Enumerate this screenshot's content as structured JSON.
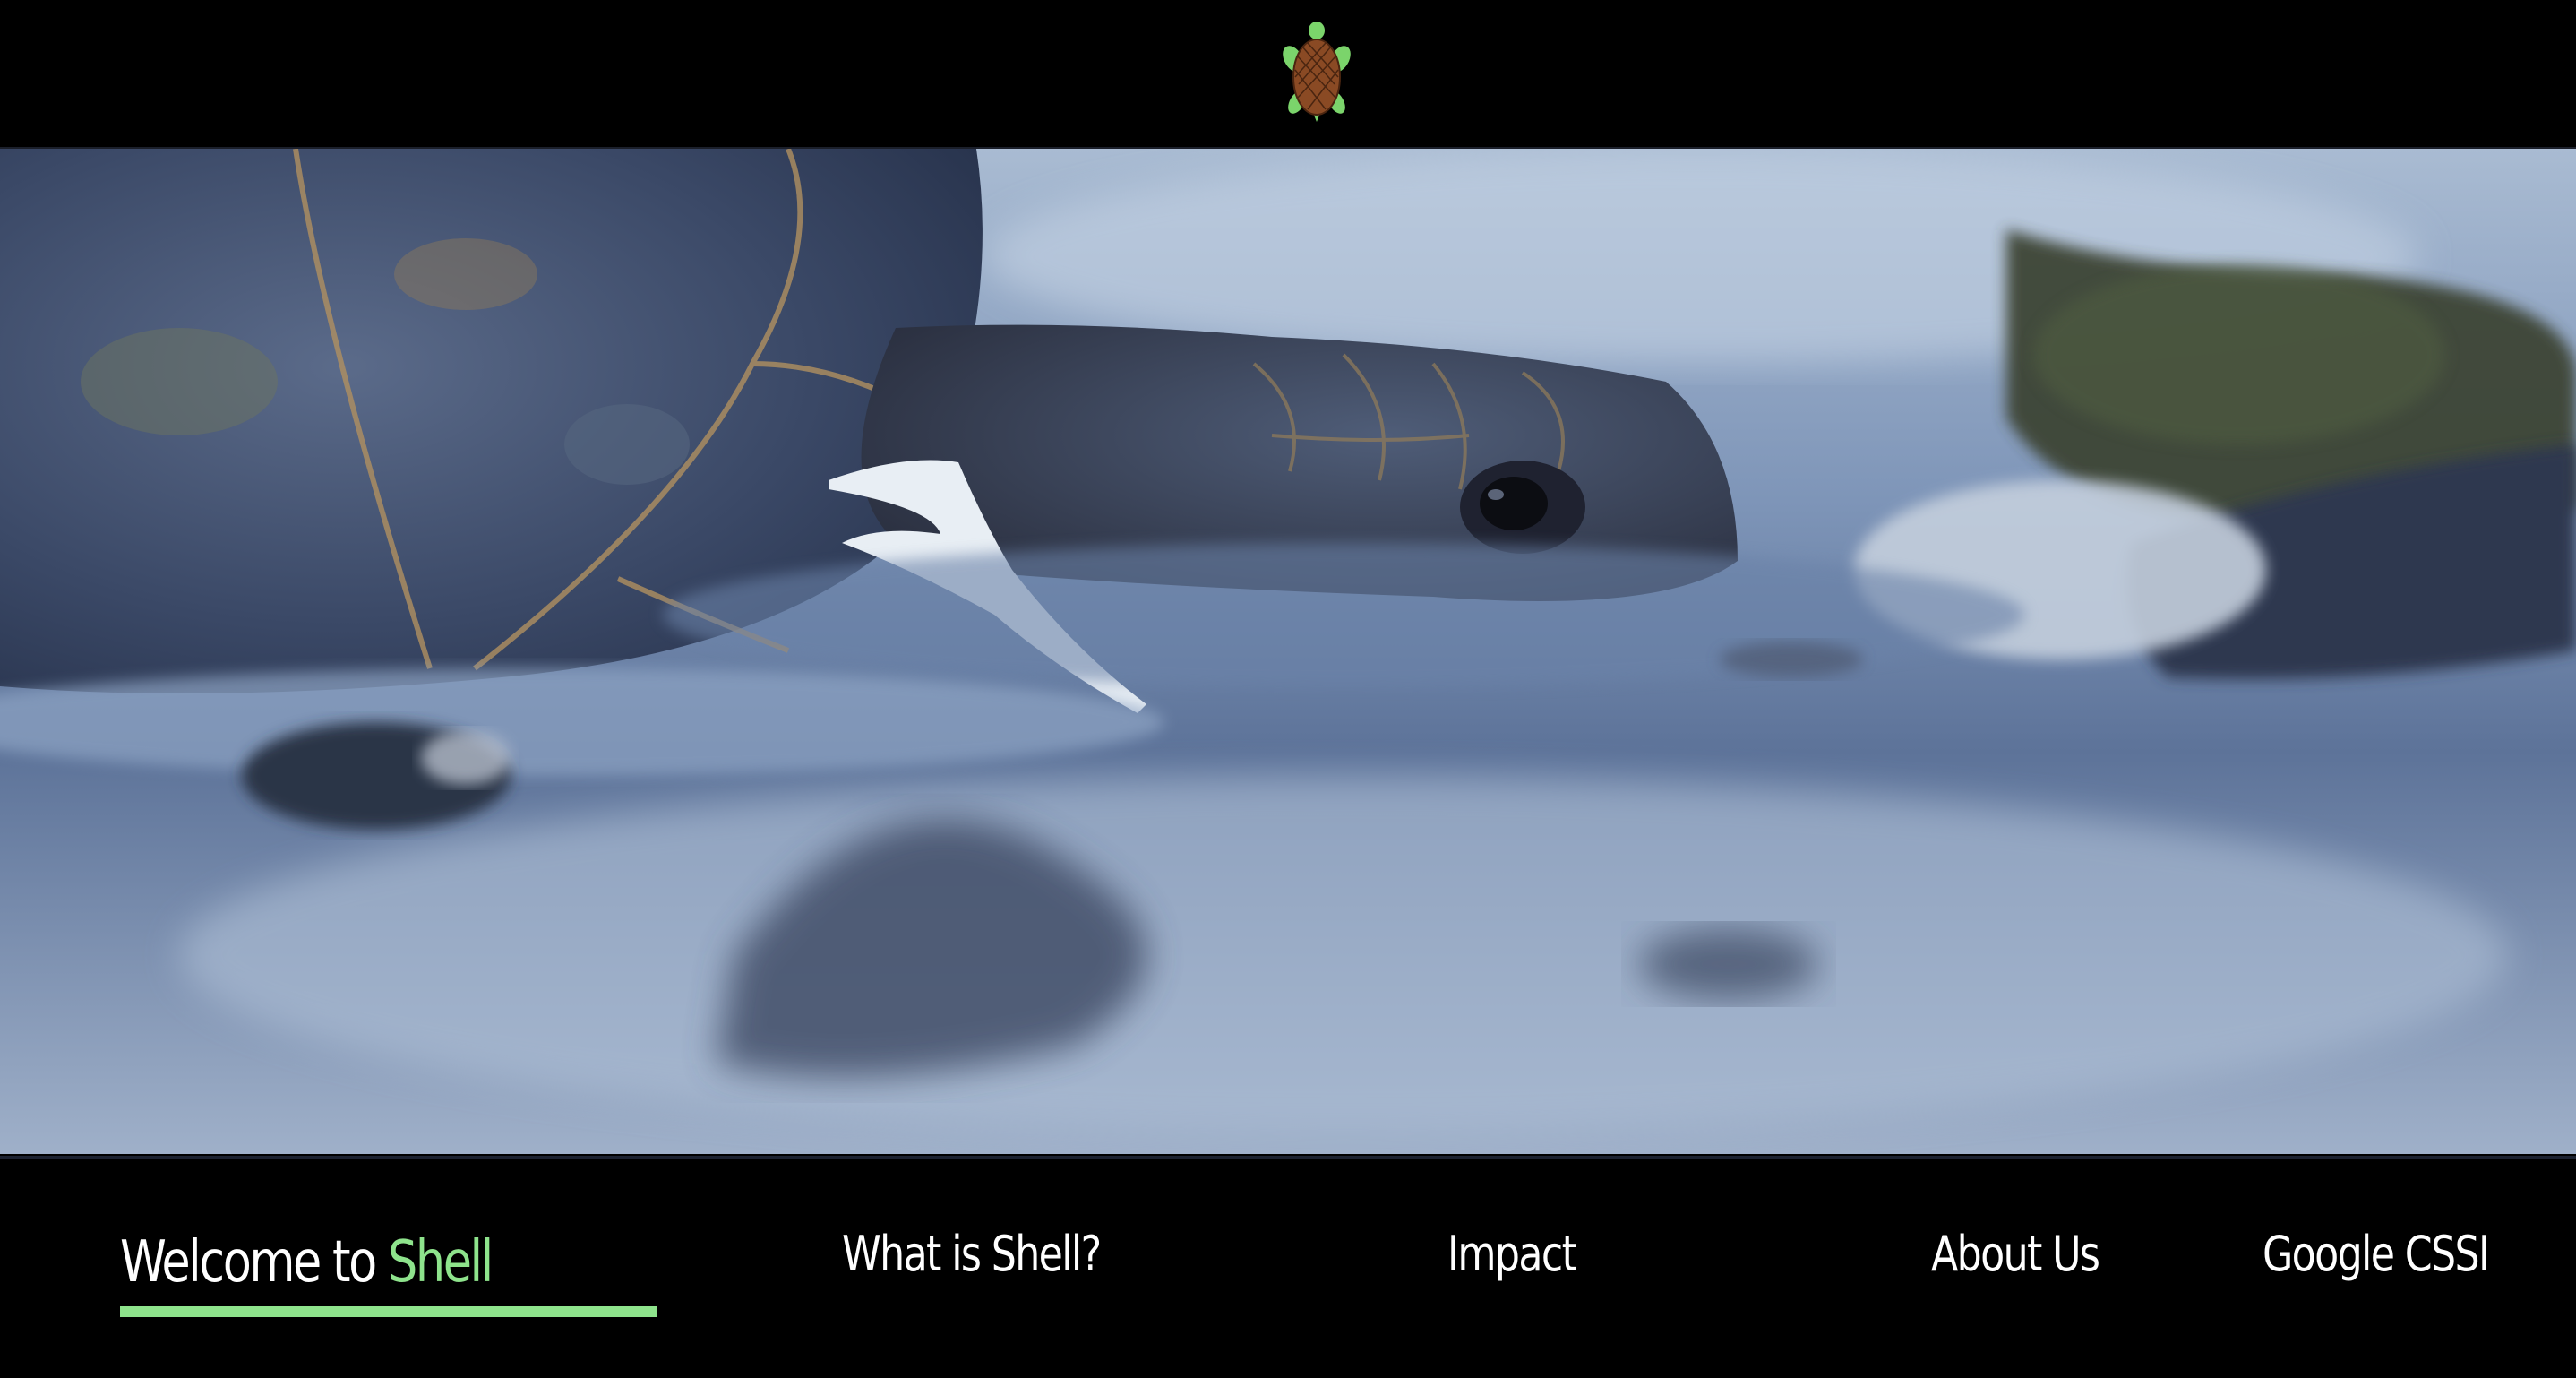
{
  "header": {
    "logo_icon": "turtle-icon"
  },
  "hero": {
    "image": "sea-turtle-with-plastic-photo"
  },
  "footer_nav": {
    "welcome_prefix": "Welcome to ",
    "brand": "Shell",
    "items": [
      {
        "label": "What is Shell?"
      },
      {
        "label": "Impact"
      },
      {
        "label": "About Us"
      },
      {
        "label": "Google CSSI"
      }
    ]
  },
  "colors": {
    "background": "#000000",
    "accent": "#8ee38c",
    "text": "#ffffff"
  }
}
